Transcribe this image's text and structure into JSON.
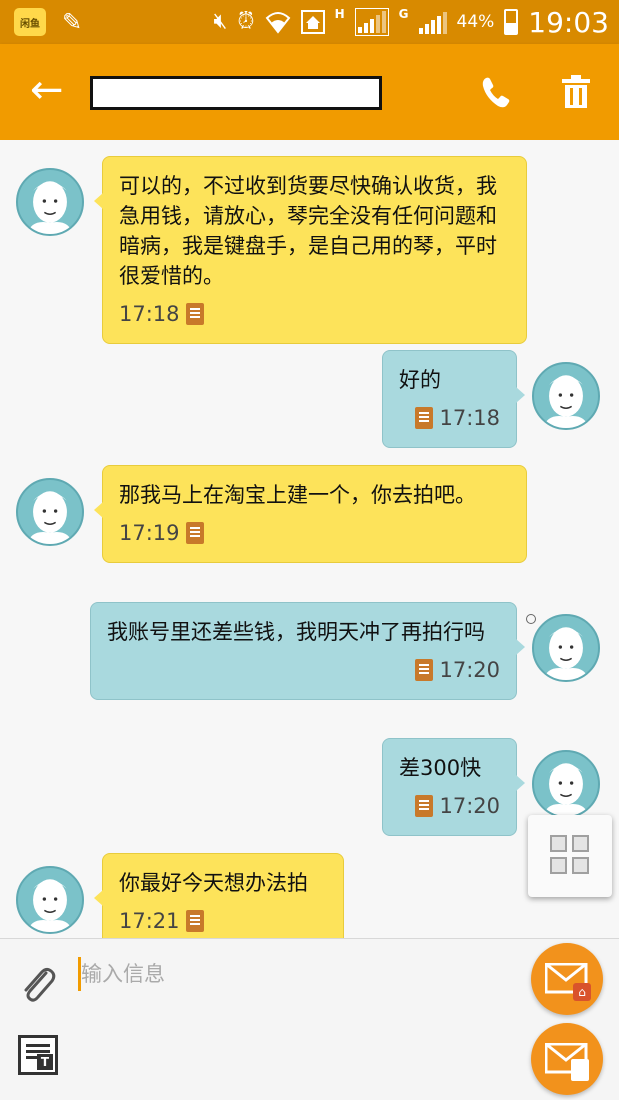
{
  "status_bar": {
    "app_badge": "闲鱼",
    "network_h": "H",
    "network_g": "G",
    "battery": "44%",
    "time": "19:03",
    "icons": [
      "pencil-icon",
      "mute-icon",
      "alarm-icon",
      "wifi-icon",
      "home-icon",
      "signal-icon",
      "battery-icon"
    ]
  },
  "app_bar": {
    "back_icon": "←",
    "contact_name": "",
    "call_icon": "phone-icon",
    "delete_icon": "trash-icon",
    "accent": "#f19b00"
  },
  "messages": [
    {
      "direction": "incoming",
      "text": "可以的，不过收到货要尽快确认收货，我急用钱，请放心，琴完全没有任何问题和暗病，我是键盘手，是自己用的琴，平时很爱惜的。",
      "time": "17:18"
    },
    {
      "direction": "outgoing",
      "text": "好的",
      "time": "17:18"
    },
    {
      "direction": "incoming",
      "text": "那我马上在淘宝上建一个，你去拍吧。",
      "time": "17:19"
    },
    {
      "direction": "outgoing",
      "text": "我账号里还差些钱，我明天冲了再拍行吗",
      "time": "17:20"
    },
    {
      "direction": "outgoing",
      "text": "差300快",
      "time": "17:20"
    },
    {
      "direction": "incoming",
      "text": "你最好今天想办法拍",
      "time": "17:21"
    }
  ],
  "composer": {
    "placeholder": "输入信息",
    "attach_icon": "paperclip-icon",
    "template_icon": "text-template-icon",
    "template_glyph": "T",
    "send_sub_glyph": "⌂"
  },
  "colors": {
    "incoming_bubble": "#fde35a",
    "outgoing_bubble": "#a9d9de",
    "send_button": "#f2921c"
  }
}
